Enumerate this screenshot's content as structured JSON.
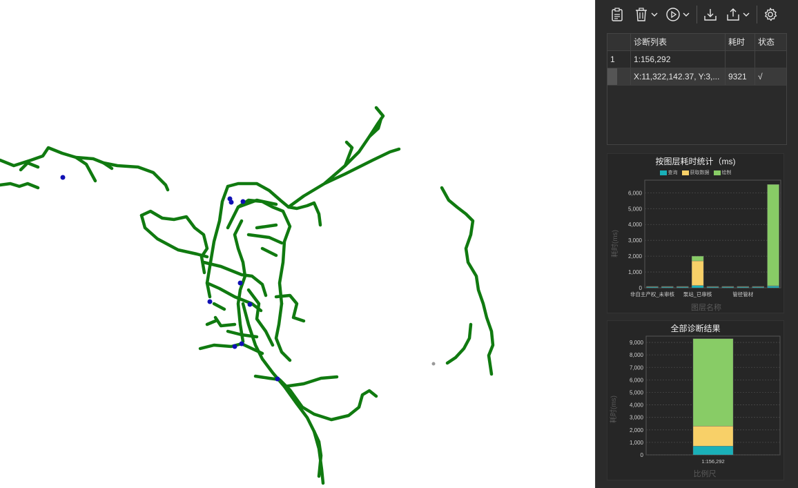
{
  "colors": {
    "network": "#107a10",
    "points": "#1010b4",
    "query": "#1ab0b8",
    "fetch": "#f8d068",
    "draw": "#88cc66"
  },
  "toolbar": {
    "buttons": [
      {
        "name": "clipboard-icon"
      },
      {
        "name": "delete-icon"
      },
      {
        "name": "play-icon"
      },
      {
        "name": "download-icon"
      },
      {
        "name": "export-icon"
      },
      {
        "name": "gear-icon"
      }
    ]
  },
  "table": {
    "headers": [
      "",
      "诊断列表",
      "耗时",
      "状态"
    ],
    "rows": [
      [
        "1",
        "1:156,292",
        "",
        ""
      ],
      [
        "",
        "X:11,322,142.37, Y:3,...",
        "9321",
        "√"
      ]
    ]
  },
  "chart1": {
    "title": "按图层耗时统计（ms)",
    "legend": [
      "查询",
      "获取数据",
      "绘制"
    ],
    "xlabel": "图层名称",
    "ylabel": "耗时(ms)",
    "yticks": [
      "0",
      "1,000",
      "2,000",
      "3,000",
      "4,000",
      "5,000",
      "6,000"
    ],
    "xticklabels": [
      "非自主产权_未审核",
      "泵站_已审核",
      "管径管材"
    ]
  },
  "chart2": {
    "title": "全部诊断结果",
    "xlabel": "比例尺",
    "ylabel": "耗时(ms)",
    "yticks": [
      "0",
      "1,000",
      "2,000",
      "3,000",
      "4,000",
      "5,000",
      "6,000",
      "7,000",
      "8,000",
      "9,000"
    ],
    "xticklabels": [
      "1:156,292"
    ]
  },
  "chart_data": [
    {
      "type": "bar",
      "stacked": true,
      "title": "按图层耗时统计（ms)",
      "xlabel": "图层名称",
      "ylabel": "耗时(ms)",
      "ylim": [
        0,
        6800
      ],
      "categories": [
        "非自主产权_未审核",
        "",
        "",
        "泵站_已审核",
        "",
        "",
        "管径管材",
        "",
        ""
      ],
      "series": [
        {
          "name": "查询",
          "values": [
            60,
            60,
            60,
            150,
            60,
            60,
            60,
            60,
            120
          ]
        },
        {
          "name": "获取数据",
          "values": [
            10,
            10,
            10,
            1550,
            10,
            10,
            10,
            10,
            10
          ]
        },
        {
          "name": "绘制",
          "values": [
            20,
            20,
            20,
            300,
            20,
            20,
            20,
            20,
            6400
          ]
        }
      ]
    },
    {
      "type": "bar",
      "stacked": true,
      "title": "全部诊断结果",
      "xlabel": "比例尺",
      "ylabel": "耗时(ms)",
      "ylim": [
        0,
        9500
      ],
      "categories": [
        "1:156,292"
      ],
      "series": [
        {
          "name": "查询",
          "values": [
            700
          ]
        },
        {
          "name": "获取数据",
          "values": [
            1600
          ]
        },
        {
          "name": "绘制",
          "values": [
            7000
          ]
        }
      ]
    }
  ]
}
